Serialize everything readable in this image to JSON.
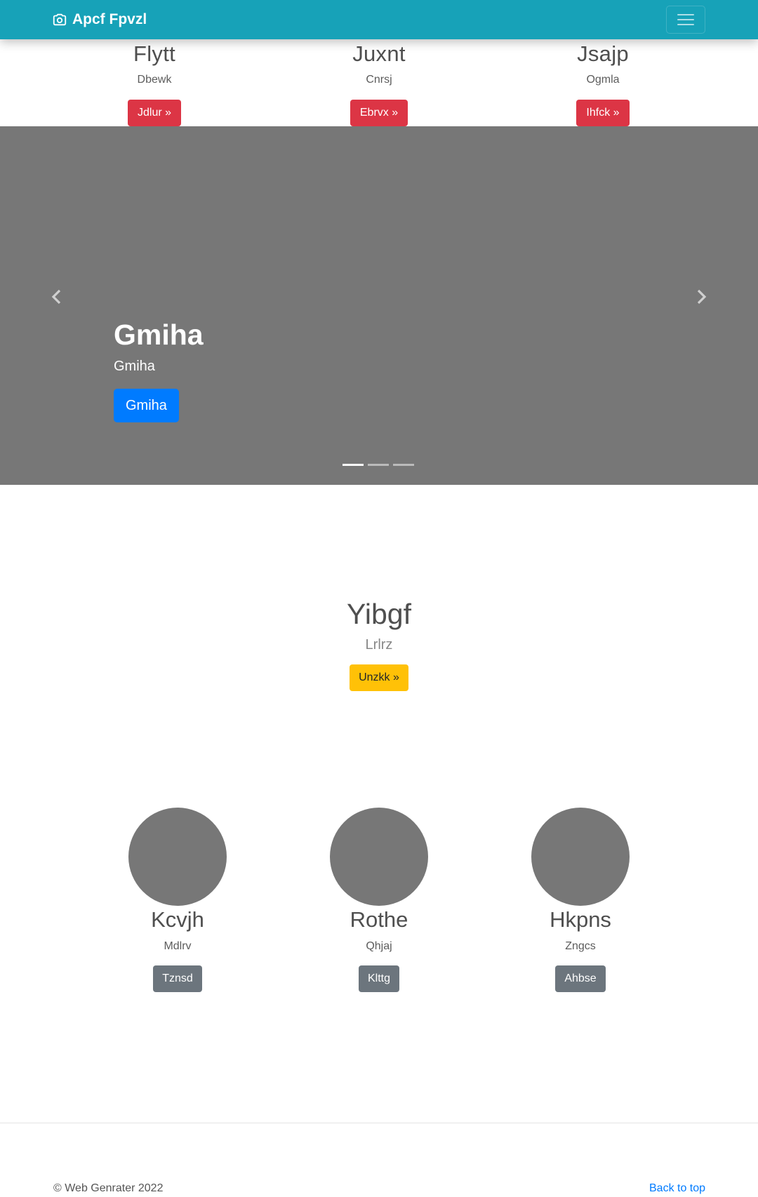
{
  "navbar": {
    "brand": "Apcf Fpvzl",
    "brand_icon": "camera-icon",
    "toggler_icon": "hamburger-menu-icon",
    "background": "#17a2b8"
  },
  "features": [
    {
      "title": "Flytt",
      "text": "Dbewk",
      "button": "Jdlur »"
    },
    {
      "title": "Juxnt",
      "text": "Cnrsj",
      "button": "Ebrvx »"
    },
    {
      "title": "Jsajp",
      "text": "Ogmla",
      "button": "Ihfck »"
    }
  ],
  "carousel": {
    "title": "Gmiha",
    "text": "Gmiha",
    "button": "Gmiha",
    "prev_icon": "chevron-left-icon",
    "next_icon": "chevron-right-icon",
    "slide_count": 3,
    "active_slide": 1
  },
  "highlight": {
    "title": "Yibgf",
    "text": "Lrlrz",
    "button": "Unzkk »"
  },
  "team": [
    {
      "name": "Kcvjh",
      "text": "Mdlrv",
      "button": "Tznsd"
    },
    {
      "name": "Rothe",
      "text": "Qhjaj",
      "button": "Klttg"
    },
    {
      "name": "Hkpns",
      "text": "Zngcs",
      "button": "Ahbse"
    }
  ],
  "footer": {
    "copyright": "© Web Genrater 2022",
    "back_to_top": "Back to top"
  },
  "colors": {
    "danger": "#dc3545",
    "primary": "#007bff",
    "warning": "#ffc107",
    "secondary": "#6c757d",
    "placeholder": "#777777"
  }
}
